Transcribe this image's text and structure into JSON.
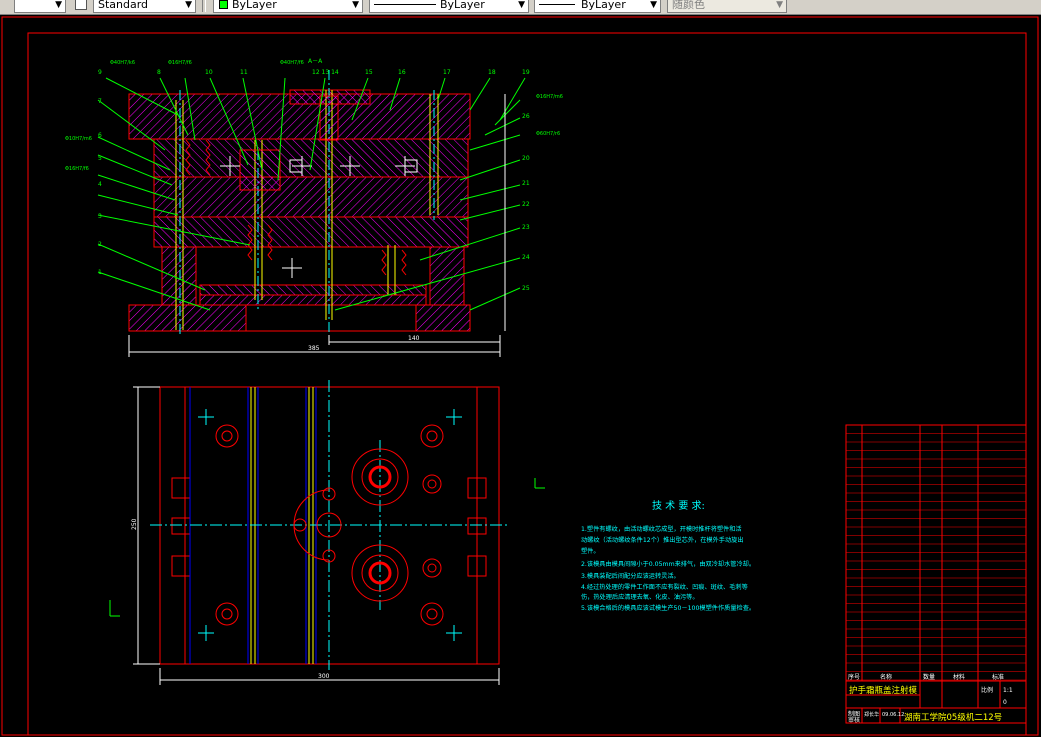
{
  "toolbar": {
    "text_style": "Standard",
    "color": "ByLayer",
    "linetype": "ByLayer",
    "lineweight": "ByLayer",
    "plot_style": "随颜色"
  },
  "drawing": {
    "section_label": "A－A",
    "fit_labels": [
      "Φ40H7/k6",
      "Φ16H7/f6",
      "Φ40H7/f6",
      "Φ10H7/m6",
      "Φ16H7/f6",
      "Φ16H7/m6",
      "Φ60H7/r6",
      "Φ10H7/f6"
    ],
    "part_numbers_top": [
      "9",
      "8",
      "10",
      "11",
      "12 13 14",
      "15",
      "16",
      "17",
      "18",
      "19"
    ],
    "part_numbers_left": [
      "7",
      "6",
      "5",
      "4",
      "3",
      "2",
      "1"
    ],
    "part_numbers_right": [
      "20",
      "21",
      "22",
      "23",
      "24",
      "25",
      "26"
    ],
    "dim_total": "385",
    "dim_half": "140",
    "dim_bottom": "300",
    "dim_left": "250",
    "tech_title": "技 术 要 求:",
    "tech_items": [
      "1.塑件有螺纹，由活动螺纹芯成型，开模时推杆将塑件和活",
      "   动螺纹（活动螺纹条件12个）推出型芯外，在模外手动旋出",
      "   塑件。",
      "2.该模具由模具间隙小于0.05mm来排气，由双冷却水管冷却。",
      "3.模具装配后间配分应该运转灵活。",
      "4.经过热处理的零件工作面不应有裂纹、凹痕、斑纹、毛刺等",
      "   伤，热处理后应清理去氧、化皮、油污等。",
      "5.该模合格后的模具应该试模生产50－100模塑件作质量检查。"
    ],
    "title_block": {
      "product_name": "护手霜瓶盖注射模",
      "school": "湖南工学院05级机二12号",
      "label_seq": "序号",
      "label_name": "名称",
      "label_qty": "数量",
      "label_material": "材料",
      "label_standard": "标准",
      "label_scale": "比例",
      "label_ratio": "1:1",
      "label_drawn": "制图",
      "label_check": "审核",
      "drawer": "郑长华",
      "date": "09.06.12",
      "sheet_no": "0"
    }
  }
}
